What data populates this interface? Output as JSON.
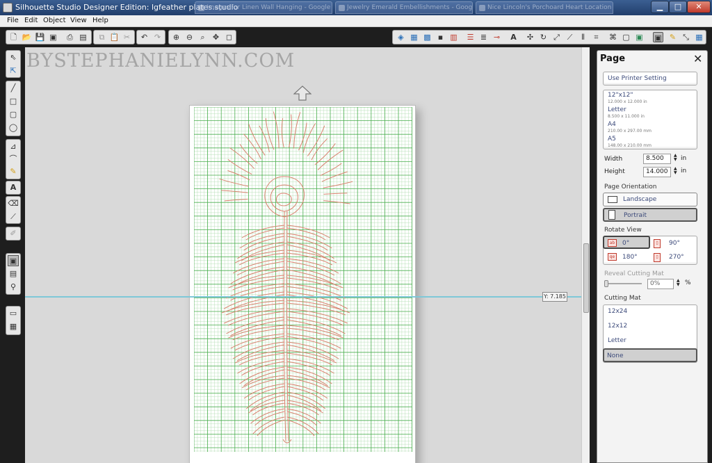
{
  "window": {
    "title": "Silhouette Studio Designer Edition: lgfeather plates.studio",
    "background_tabs": [
      "Images for Linen Wall Hanging - Google Se...",
      "Jewelry Emerald Embellishments - Google...",
      "Nice Lincoln's Porchoard Heart Location t..."
    ],
    "controls": {
      "minimize": "▁",
      "maximize": "□",
      "close": "✕"
    }
  },
  "menu": [
    "File",
    "Edit",
    "Object",
    "View",
    "Help"
  ],
  "toolbar_icons": {
    "file_group": [
      "new-document-icon",
      "open-icon",
      "save-icon",
      "save-to-library-icon",
      "print-icon",
      "print-and-cut-icon"
    ],
    "clipboard_group": [
      "copy-icon",
      "paste-icon",
      "cut-icon"
    ],
    "undo_group": [
      "undo-icon",
      "redo-icon"
    ],
    "zoom_group": [
      "zoom-in-icon",
      "zoom-out-icon",
      "zoom-select-icon",
      "pan-icon",
      "fit-to-page-icon"
    ],
    "panel_group": [
      "fill-color-icon",
      "line-color-icon",
      "fill-pattern-icon",
      "gradient-icon",
      "align-icon",
      "line-style-icon",
      "replicate-icon",
      "offset-icon",
      "text-style-icon",
      "transform-icon",
      "rotate-icon",
      "scale-icon",
      "knife-icon",
      "trace-icon",
      "cut-settings-icon",
      "library-icon",
      "store-icon",
      "page-settings-icon",
      "sketch-icon",
      "fullscreen-icon",
      "grid-icon"
    ]
  },
  "watermark": "BYSTEPHANIELYNN.COM",
  "canvas": {
    "guide_readout": "Y: 7.185"
  },
  "panel": {
    "title": "Page",
    "close_label": "✕",
    "use_printer_setting": "Use Printer Setting",
    "page_sizes": [
      {
        "name": "12\"x12\"",
        "dims": "12.000 x 12.000 in"
      },
      {
        "name": "Letter",
        "dims": "8.500 x 11.000 in"
      },
      {
        "name": "A4",
        "dims": "210.00 x 297.00 mm"
      },
      {
        "name": "A5",
        "dims": "148.00 x 210.00 mm"
      }
    ],
    "width_label": "Width",
    "width_value": "8.500",
    "height_label": "Height",
    "height_value": "14.000",
    "unit": "in",
    "page_orientation_label": "Page Orientation",
    "orientation_options": [
      "Landscape",
      "Portrait"
    ],
    "orientation_selected": "Portrait",
    "rotate_view_label": "Rotate View",
    "rotate_options": [
      "0°",
      "90°",
      "180°",
      "270°"
    ],
    "rotate_selected": "0°",
    "reveal_cutting_mat_label": "Reveal Cutting Mat",
    "reveal_value": "0%",
    "reveal_unit": "%",
    "reveal_level": 0,
    "cutting_mat_label": "Cutting Mat",
    "cutting_mat_options": [
      "12x24",
      "12x12",
      "Letter",
      "None"
    ],
    "cutting_mat_selected": "None"
  },
  "colors": {
    "grid_major": "#4caf50",
    "grid_minor": "#b8e0b8",
    "cut_line": "#d9826f",
    "guide": "#7ec8d8",
    "title_bar": "#2b4b7d"
  }
}
